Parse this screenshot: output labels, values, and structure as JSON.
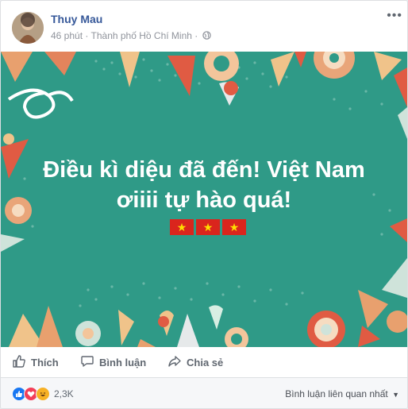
{
  "post": {
    "author": "Thuy Mau",
    "time": "46 phút",
    "separator": "·",
    "location": "Thành phố Hồ Chí Minh",
    "privacy_icon": "globe-icon",
    "menu_icon": "more-icon"
  },
  "banner": {
    "line1": "Điều kì diệu đã đến! Việt Nam",
    "line2": "ơiiii tự hào quá!",
    "background_color": "#2f9a87",
    "flags": [
      "★",
      "★",
      "★"
    ]
  },
  "actions": {
    "like": "Thích",
    "comment": "Bình luận",
    "share": "Chia sẻ"
  },
  "footer": {
    "reaction_icons": [
      "like-icon",
      "love-icon",
      "haha-icon"
    ],
    "reaction_count": "2,3K",
    "sort_label": "Bình luận liên quan nhất"
  }
}
